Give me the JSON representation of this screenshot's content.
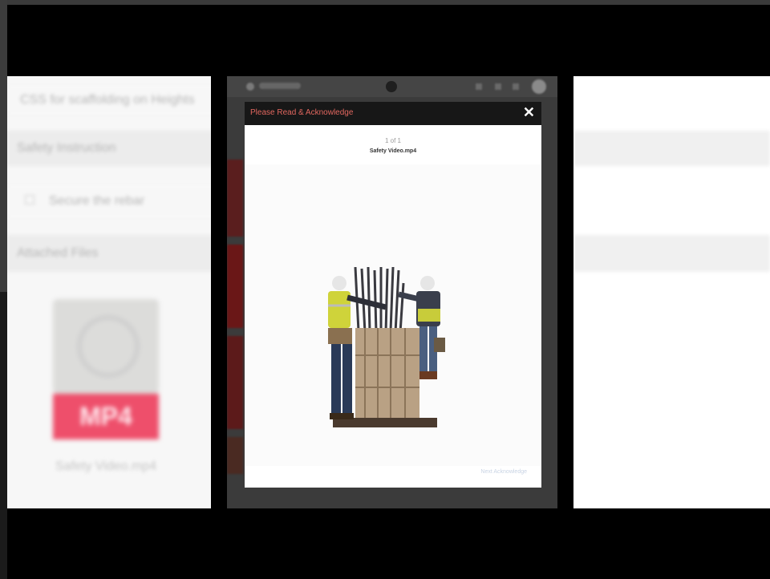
{
  "left_panel": {
    "title": "CSS for scaffolding on Heights",
    "section1": "Safety Instruction",
    "item": "Secure the rebar",
    "section2": "Attached Files",
    "badge": "MP4",
    "caption": "Safety Video.mp4"
  },
  "modal": {
    "title": "Please Read & Acknowledge",
    "close_icon": "close-icon",
    "counter": "1 of 1",
    "file_name": "Safety Video.mp4",
    "footer_link": "Next Acknowledge"
  },
  "colors": {
    "modal_title": "#e2675f",
    "badge": "#ee4f6b",
    "modal_header": "#171717"
  }
}
